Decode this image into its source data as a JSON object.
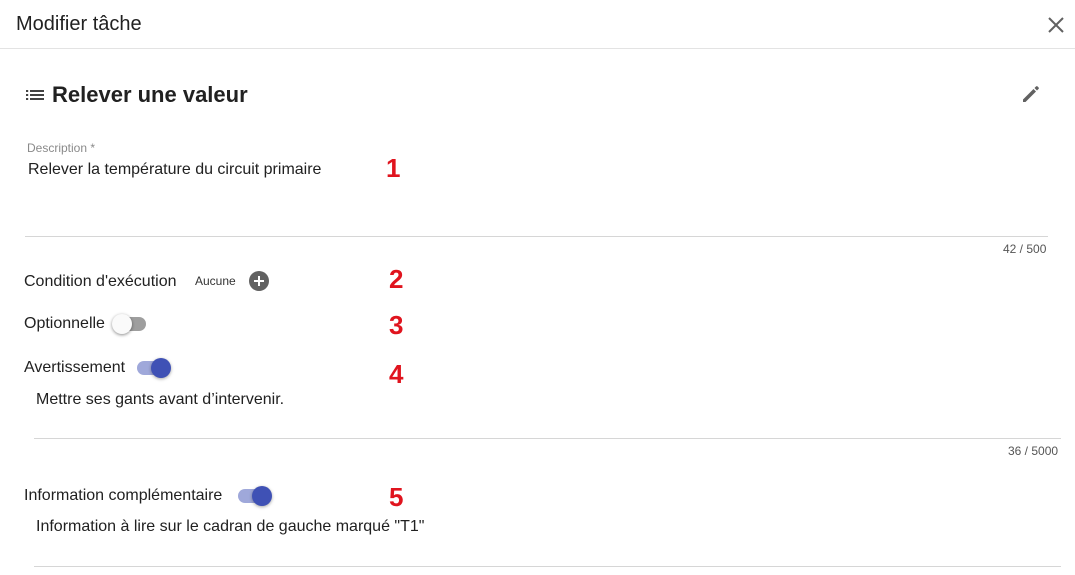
{
  "dialog": {
    "title": "Modifier tâche",
    "close_icon": "close-icon"
  },
  "task": {
    "icon": "list-icon",
    "title": "Relever une valeur",
    "edit_icon": "pencil-icon"
  },
  "description": {
    "label": "Description *",
    "value": "Relever la température du circuit primaire",
    "counter": "42 / 500"
  },
  "condition": {
    "label": "Condition d'exécution",
    "value": "Aucune",
    "add_icon": "add-circle-icon"
  },
  "optional": {
    "label": "Optionnelle",
    "enabled": false
  },
  "warning": {
    "label": "Avertissement",
    "enabled": true,
    "text": "Mettre ses gants avant d’intervenir.",
    "counter": "36 / 5000"
  },
  "additional_info": {
    "label": "Information complémentaire",
    "enabled": true,
    "text": "Information à lire sur le cadran de gauche marqué \"T1\""
  },
  "markers": [
    "1",
    "2",
    "3",
    "4",
    "5"
  ],
  "colors": {
    "accent": "#3f51b5",
    "accent_light": "#9fa8da",
    "marker": "#e0141e"
  }
}
